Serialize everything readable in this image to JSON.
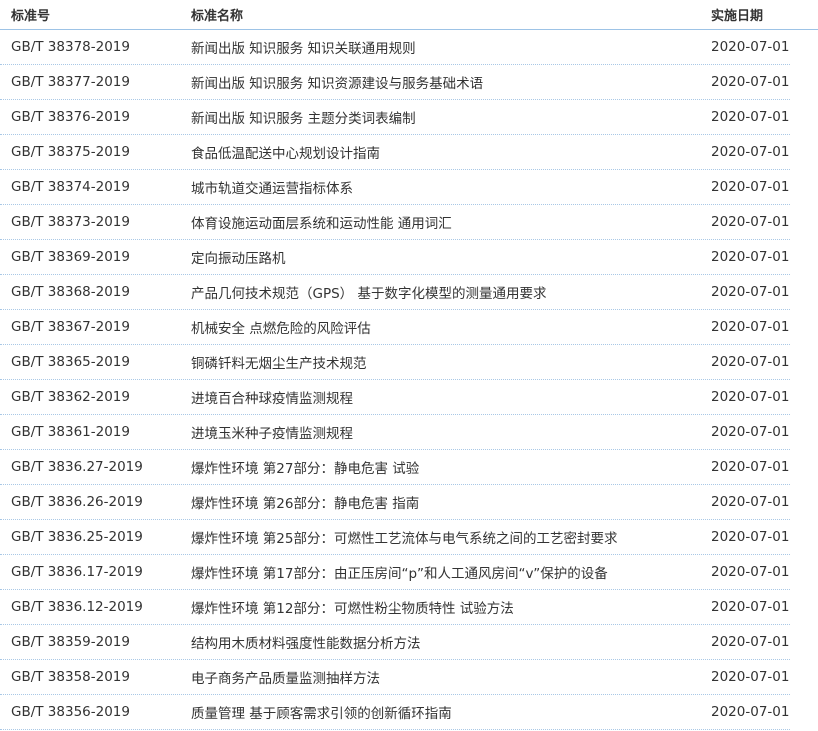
{
  "headers": {
    "number": "标准号",
    "name": "标准名称",
    "date": "实施日期"
  },
  "rows": [
    {
      "number": "GB/T 38378-2019",
      "name": "新闻出版 知识服务 知识关联通用规则",
      "date": "2020-07-01"
    },
    {
      "number": "GB/T 38377-2019",
      "name": "新闻出版 知识服务 知识资源建设与服务基础术语",
      "date": "2020-07-01"
    },
    {
      "number": "GB/T 38376-2019",
      "name": "新闻出版 知识服务 主题分类词表编制",
      "date": "2020-07-01"
    },
    {
      "number": "GB/T 38375-2019",
      "name": "食品低温配送中心规划设计指南",
      "date": "2020-07-01"
    },
    {
      "number": "GB/T 38374-2019",
      "name": "城市轨道交通运营指标体系",
      "date": "2020-07-01"
    },
    {
      "number": "GB/T 38373-2019",
      "name": "体育设施运动面层系统和运动性能 通用词汇",
      "date": "2020-07-01"
    },
    {
      "number": "GB/T 38369-2019",
      "name": "定向振动压路机",
      "date": "2020-07-01"
    },
    {
      "number": "GB/T 38368-2019",
      "name": "产品几何技术规范（GPS） 基于数字化模型的测量通用要求",
      "date": "2020-07-01"
    },
    {
      "number": "GB/T 38367-2019",
      "name": "机械安全 点燃危险的风险评估",
      "date": "2020-07-01"
    },
    {
      "number": "GB/T 38365-2019",
      "name": "铜磷钎料无烟尘生产技术规范",
      "date": "2020-07-01"
    },
    {
      "number": "GB/T 38362-2019",
      "name": "进境百合种球疫情监测规程",
      "date": "2020-07-01"
    },
    {
      "number": "GB/T 38361-2019",
      "name": "进境玉米种子疫情监测规程",
      "date": "2020-07-01"
    },
    {
      "number": "GB/T 3836.27-2019",
      "name": "爆炸性环境 第27部分：静电危害 试验",
      "date": "2020-07-01"
    },
    {
      "number": "GB/T 3836.26-2019",
      "name": "爆炸性环境 第26部分：静电危害 指南",
      "date": "2020-07-01"
    },
    {
      "number": "GB/T 3836.25-2019",
      "name": "爆炸性环境 第25部分：可燃性工艺流体与电气系统之间的工艺密封要求",
      "date": "2020-07-01"
    },
    {
      "number": "GB/T 3836.17-2019",
      "name": "爆炸性环境 第17部分：由正压房间“p”和人工通风房间“v”保护的设备",
      "date": "2020-07-01"
    },
    {
      "number": "GB/T 3836.12-2019",
      "name": "爆炸性环境 第12部分：可燃性粉尘物质特性 试验方法",
      "date": "2020-07-01"
    },
    {
      "number": "GB/T 38359-2019",
      "name": "结构用木质材料强度性能数据分析方法",
      "date": "2020-07-01"
    },
    {
      "number": "GB/T 38358-2019",
      "name": "电子商务产品质量监测抽样方法",
      "date": "2020-07-01"
    },
    {
      "number": "GB/T 38356-2019",
      "name": "质量管理 基于顾客需求引领的创新循环指南",
      "date": "2020-07-01"
    }
  ]
}
